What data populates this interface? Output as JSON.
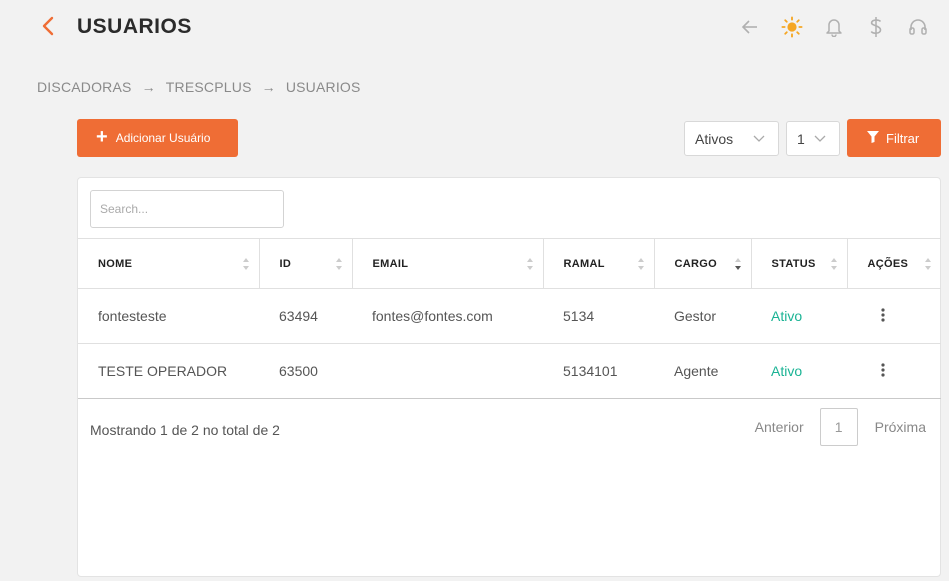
{
  "header": {
    "title": "USUARIOS"
  },
  "breadcrumb": [
    "DISCADORAS",
    "TRESCPLUS",
    "USUARIOS"
  ],
  "breadcrumb_separator": "→",
  "toolbar": {
    "add_label": "Adicionar Usuário",
    "status_select": "Ativos",
    "page_select": "1",
    "filter_label": "Filtrar"
  },
  "search": {
    "placeholder": "Search..."
  },
  "table": {
    "columns": [
      "NOME",
      "ID",
      "EMAIL",
      "RAMAL",
      "CARGO",
      "STATUS",
      "AÇÕES"
    ],
    "rows": [
      {
        "nome": "fontesteste",
        "id": "63494",
        "email": "fontes@fontes.com",
        "ramal": "5134",
        "cargo": "Gestor",
        "status": "Ativo"
      },
      {
        "nome": "TESTE OPERADOR",
        "id": "63500",
        "email": "",
        "ramal": "5134101",
        "cargo": "Agente",
        "status": "Ativo"
      }
    ]
  },
  "footer": {
    "info": "Mostrando 1 de 2 no total de 2",
    "prev": "Anterior",
    "current_page": "1",
    "next": "Próxima"
  },
  "colors": {
    "accent": "#ef6d35",
    "active": "#1ab394",
    "sun": "#f5a623"
  }
}
